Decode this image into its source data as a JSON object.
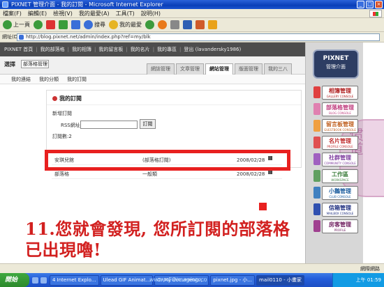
{
  "window": {
    "title": "PIXNET 管理介面 - 我的訂閱 - Microsoft Internet Explorer",
    "buttons": [
      "_",
      "□",
      "×"
    ]
  },
  "menu": [
    "檔案(F)",
    "編輯(E)",
    "檢視(V)",
    "我的最愛(A)",
    "工具(T)",
    "說明(H)"
  ],
  "toolbar": {
    "back": "上一頁",
    "search": "搜尋",
    "favorites": "我的最愛"
  },
  "address": {
    "label": "網址(D)",
    "url": "http://blog.pixnet.net/admin/index.php?ref=my/blk"
  },
  "topnav": [
    "PIXNET 首頁",
    "我的部落格",
    "我的相簿",
    "我的留言板",
    "我的名片",
    "我的專區",
    "登出 (lavandersky1986)"
  ],
  "header": {
    "select_label": "選擇",
    "select_value": "部落格管理"
  },
  "tabs": [
    {
      "label": "網誌管理",
      "active": false
    },
    {
      "label": "文章管理",
      "active": false
    },
    {
      "label": "網站管理",
      "active": true
    },
    {
      "label": "版面管理",
      "active": false
    },
    {
      "label": "我的三八",
      "active": false
    }
  ],
  "subnav": [
    "我的連結",
    "我的分類",
    "我的訂閱"
  ],
  "panel": {
    "title": "我的訂閱",
    "new_sub": "新增訂閱",
    "rss_label": "RSS網址:",
    "rss_button": "訂閱",
    "count": "訂閱數:2"
  },
  "rows": [
    {
      "name": "安琪兒館",
      "category": "(部落格訂閱)",
      "date": "2008/02/28"
    },
    {
      "name": "部落格",
      "category": "一般類",
      "date": "2008/02/28"
    }
  ],
  "sidebar": {
    "logo_title": "PIXNET",
    "logo_sub": "管理介面",
    "items": [
      {
        "label": "相簿管理",
        "en": "GALLERY CONSOLE",
        "bg": "#ffffff",
        "color": "#b02020",
        "badge": "#e04040"
      },
      {
        "label": "部落格管理",
        "en": "BLOG CONSOLE",
        "bg": "#ffffff",
        "color": "#c04080",
        "badge": "#e080b0"
      },
      {
        "label": "留言板管理",
        "en": "GUESTBOOK CONSOLE",
        "bg": "#ffffff",
        "color": "#c06020",
        "badge": "#f0a040"
      },
      {
        "label": "名片管理",
        "en": "PROFILE CONSOLE",
        "bg": "#ffffff",
        "color": "#c03030",
        "badge": "#e05050"
      },
      {
        "label": "社群管理",
        "en": "COMMUNITY CONSOLE",
        "bg": "#ffffff",
        "color": "#8040a0",
        "badge": "#a060c0"
      },
      {
        "label": "工作區",
        "en": "WORKSPACE",
        "bg": "#ffffff",
        "color": "#408040",
        "badge": "#60a060"
      },
      {
        "label": "小鵝管理",
        "en": "CLUB CONSOLE",
        "bg": "#ffffff",
        "color": "#2060a0",
        "badge": "#4080c0"
      },
      {
        "label": "信箱管理",
        "en": "MAILBOX CONSOLE",
        "bg": "#ffffff",
        "color": "#203080",
        "badge": "#3050b0"
      },
      {
        "label": "房客管理",
        "en": "PROFILE",
        "bg": "#ffffff",
        "color": "#702060",
        "badge": "#a04090"
      }
    ]
  },
  "caption": {
    "line1": "11.您就會發現, 您所訂閱的部落格",
    "line2": "已出現嚕!"
  },
  "status": {
    "left": "",
    "right": "網際網路"
  },
  "taskbar": {
    "start": "開始",
    "tasks": [
      "4 Internet Explo...",
      "Ulead GIF Animat...",
      "C:\\My documents\\...",
      "pixnet.jpg - 小...",
      "mail0110 - 小畫家"
    ],
    "clock": "上午 01:59",
    "site": "www.nEOimaging.cn"
  },
  "stamp": "惯道"
}
